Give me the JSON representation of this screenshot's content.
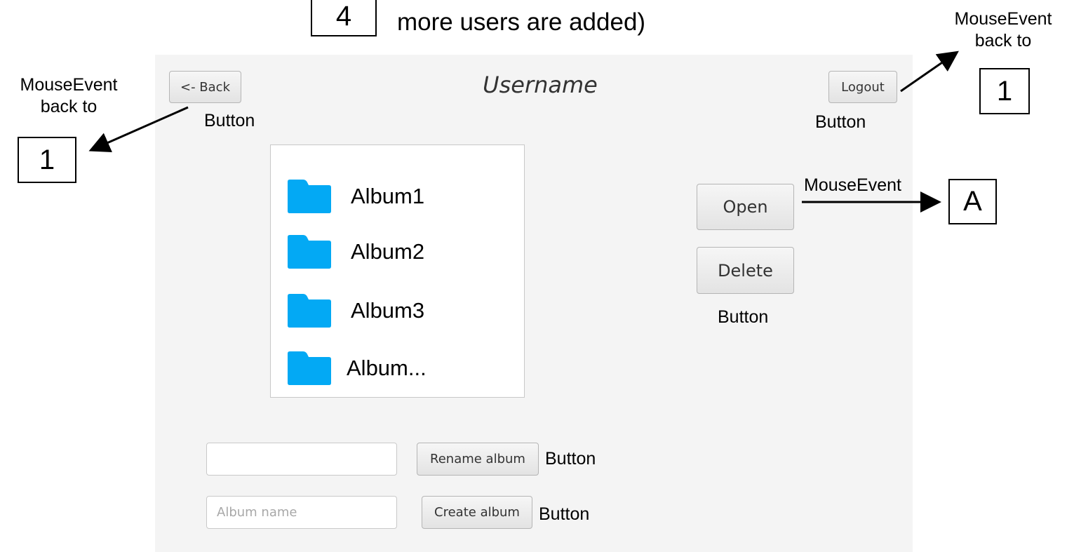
{
  "header": {
    "step_box": "4",
    "line1_partial": "...",
    "line2": "more users are added)"
  },
  "annotations": {
    "left_event": "MouseEvent\nback to",
    "left_box": "1",
    "back_button_note": "Button",
    "right_event": "MouseEvent\nback to",
    "right_box": "1",
    "logout_button_note": "Button",
    "open_event": "MouseEvent",
    "open_box": "A",
    "open_delete_note": "Button",
    "rename_note": "Button",
    "create_note": "Button"
  },
  "window": {
    "back_label": "<- Back",
    "title": "Username",
    "logout_label": "Logout",
    "albums": [
      "Album1",
      "Album2",
      "Album3",
      "Album..."
    ],
    "open_label": "Open",
    "delete_label": "Delete",
    "rename_label": "Rename album",
    "rename_value": "",
    "create_label": "Create album",
    "album_name_placeholder": "Album name"
  },
  "colors": {
    "folder": "#03a9f4",
    "window_bg": "#f4f4f4"
  }
}
